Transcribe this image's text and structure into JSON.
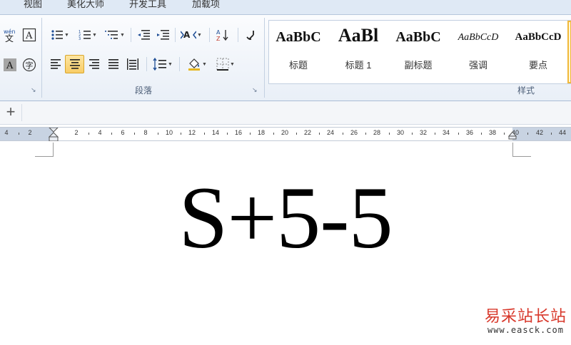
{
  "tabs": [
    "视图",
    "美化大师",
    "开发工具",
    "加载项"
  ],
  "ribbon": {
    "paragraph_group_label": "段落",
    "styles_group_label": "样式",
    "launcher_glyph": "↘",
    "sort_label": "A↓Z",
    "styles": [
      {
        "preview": "AaBbC",
        "label": "标题"
      },
      {
        "preview": "AaBl",
        "label": "标题 1"
      },
      {
        "preview": "AaBbC",
        "label": "副标题"
      },
      {
        "preview": "AaBbCcD",
        "label": "强调"
      },
      {
        "preview": "AaBbCcD",
        "label": "要点"
      }
    ]
  },
  "formula_bar": {
    "plus": "+"
  },
  "ruler": {
    "labels": [
      "4",
      "2",
      "2",
      "4",
      "6",
      "8",
      "10",
      "12",
      "14",
      "16",
      "18",
      "20",
      "22",
      "24",
      "26",
      "28",
      "30",
      "32",
      "34",
      "36",
      "38",
      "40",
      "42",
      "44"
    ]
  },
  "document": {
    "text": "S+5-5"
  },
  "watermark": {
    "text_cn": "易采站长站",
    "url": "www.easck.com"
  },
  "colors": {
    "watermark_red": "#d8382b",
    "selected_highlight": "#f8cc66"
  }
}
